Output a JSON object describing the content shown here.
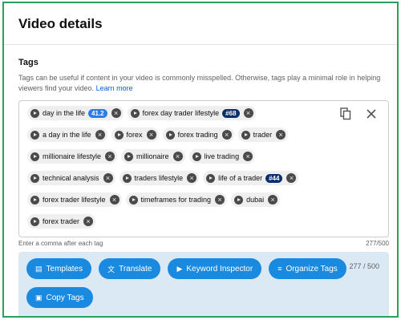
{
  "header": {
    "title": "Video details"
  },
  "tags_section": {
    "title": "Tags",
    "help_text": "Tags can be useful if content in your video is commonly misspelled. Otherwise, tags play a minimal role in helping viewers find your video.",
    "learn_more": "Learn more",
    "rows": [
      [
        {
          "text": "day in the life",
          "score": "41.2"
        },
        {
          "text": "forex day trader lifestyle",
          "rank": "#68"
        }
      ],
      [
        {
          "text": "a day in the life"
        },
        {
          "text": "forex"
        },
        {
          "text": "forex trading"
        },
        {
          "text": "trader"
        }
      ],
      [
        {
          "text": "millionaire lifestyle"
        },
        {
          "text": "millionaire"
        },
        {
          "text": "live trading"
        }
      ],
      [
        {
          "text": "technical analysis"
        },
        {
          "text": "traders lifestyle"
        },
        {
          "text": "life of a trader",
          "rank": "#44"
        }
      ],
      [
        {
          "text": "forex trader lifestyle"
        },
        {
          "text": "timeframes for trading"
        },
        {
          "text": "dubai"
        }
      ],
      [
        {
          "text": "forex trader"
        }
      ]
    ],
    "hint": "Enter a comma after each tag",
    "char_count": "277/500"
  },
  "toolbar": {
    "buttons_row1": [
      {
        "label": "Templates",
        "icon": "template-icon"
      },
      {
        "label": "Translate",
        "icon": "translate-icon"
      },
      {
        "label": "Keyword Inspector",
        "icon": "play-icon"
      },
      {
        "label": "Organize Tags",
        "icon": "sort-icon"
      }
    ],
    "buttons_row2": [
      {
        "label": "Copy Tags",
        "icon": "copy-icon"
      }
    ],
    "count": "277 / 500"
  },
  "colors": {
    "accent": "#1a8ae0",
    "frame_border": "#2e9e5b",
    "toolbar_bg": "#dbe9f5"
  }
}
